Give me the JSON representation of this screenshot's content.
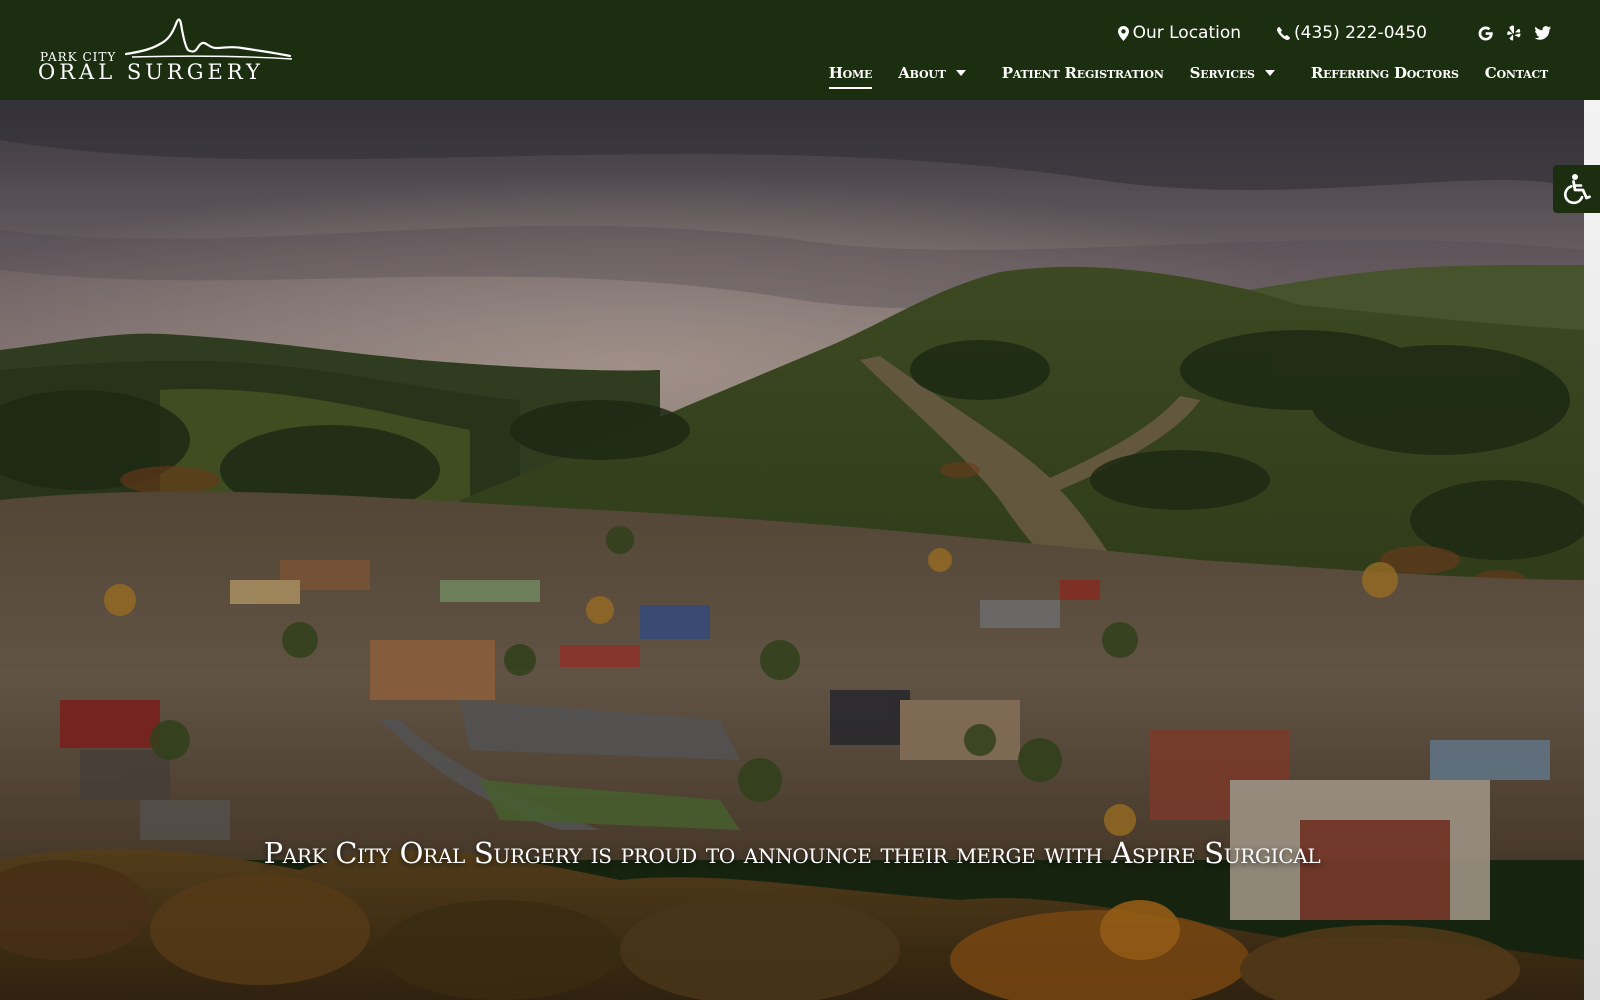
{
  "logo": {
    "small_text": "PARK CITY",
    "big_text": "ORAL  SURGERY"
  },
  "topbar": {
    "location_icon": "map-pin-icon",
    "location_label": "Our Location",
    "phone_icon": "phone-icon",
    "phone_label": "(435) 222-0450",
    "social": [
      "google-icon",
      "yelp-icon",
      "twitter-icon"
    ]
  },
  "nav": {
    "items": [
      {
        "label": "Home",
        "active": true
      },
      {
        "label": "About",
        "dropdown": true
      },
      {
        "label": "Patient Registration"
      },
      {
        "label": "Services",
        "dropdown": true
      },
      {
        "label": "Referring Doctors"
      },
      {
        "label": "Contact"
      }
    ]
  },
  "hero": {
    "headline": "Park City Oral Surgery is proud to announce their merge with Aspire Surgical"
  },
  "accessibility": {
    "icon": "wheelchair-icon"
  },
  "colors": {
    "header_bg": "#1c2e10",
    "text": "#ffffff"
  }
}
